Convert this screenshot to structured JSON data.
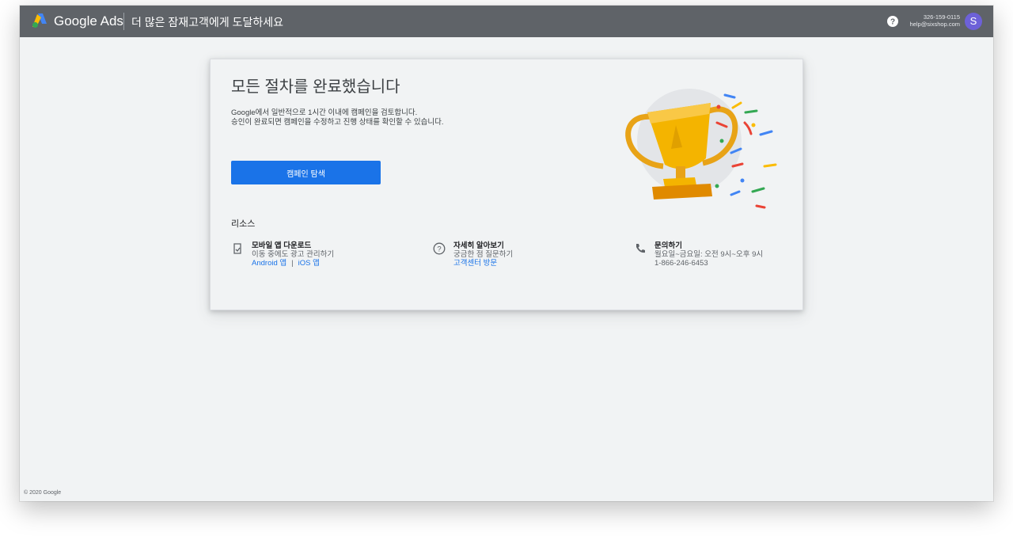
{
  "header": {
    "brand": "Google Ads",
    "headline": "더 많은 잠재고객에게 도달하세요",
    "phone": "326-159-0115",
    "email": "help@sixshop.com",
    "avatar_letter": "S"
  },
  "card": {
    "title": "모든 절차를 완료했습니다",
    "description_line1": "Google에서 일반적으로 1시간 이내에 캠페인을 검토합니다.",
    "description_line2": "승인이 완료되면 캠페인을 수정하고 진행 상태를 확인할 수 있습니다.",
    "explore_button": "캠페인 탐색"
  },
  "resources": {
    "heading": "리소스",
    "items": [
      {
        "icon": "mobile-check-icon",
        "title": "모바일 앱 다운로드",
        "subtitle": "이동 중에도 광고 관리하기",
        "link1": "Android 앱",
        "separator": "|",
        "link2": "iOS 앱"
      },
      {
        "icon": "help-circle-icon",
        "title": "자세히 알아보기",
        "subtitle": "궁금한 점 질문하기",
        "link1": "고객센터 방문"
      },
      {
        "icon": "phone-icon",
        "title": "문의하기",
        "subtitle": "월요일~금요일: 오전 9시~오후 9시",
        "line3": "1-866-246-6453"
      }
    ]
  },
  "footer": {
    "copyright": "© 2020 Google"
  },
  "colors": {
    "topbar": "#5f6368",
    "accent": "#1a73e8",
    "avatar": "#6d61d8",
    "trophy": "#f4b400"
  }
}
